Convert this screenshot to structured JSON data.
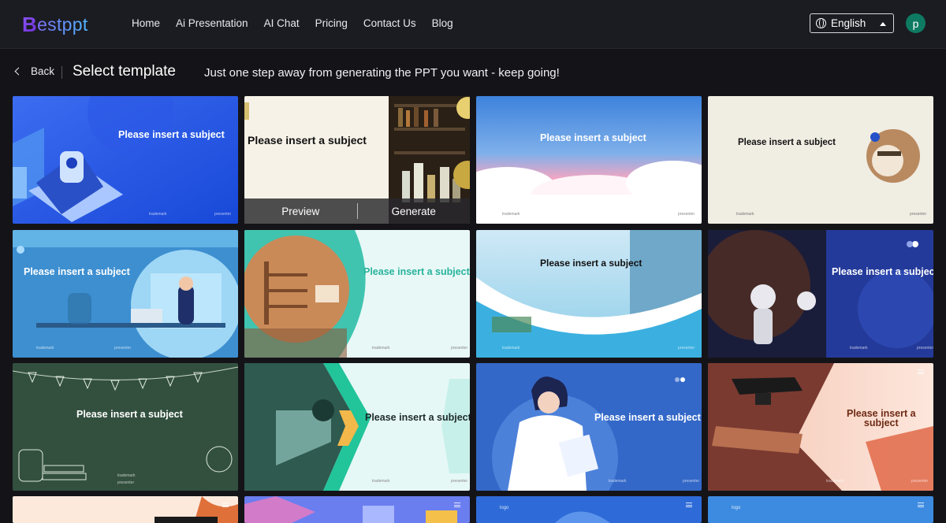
{
  "brand": {
    "b": "B",
    "rest": "estppt"
  },
  "nav": [
    "Home",
    "Ai Presentation",
    "AI Chat",
    "Pricing",
    "Contact Us",
    "Blog"
  ],
  "language": {
    "label": "English",
    "icon": "globe-icon"
  },
  "user": {
    "initial": "p",
    "color": "#0f7a62"
  },
  "header": {
    "back_label": "Back",
    "title": "Select template",
    "tagline": "Just one step away from generating the PPT you want - keep going!"
  },
  "hover_actions": {
    "preview": "Preview",
    "generate": "Generate"
  },
  "templates": [
    {
      "subject": "Please insert a subject",
      "theme": "blue-tech-laptop",
      "footer_left": "trademark",
      "footer_right": "presenter"
    },
    {
      "subject": "Please insert a subject",
      "theme": "cream-bottles"
    },
    {
      "subject": "Please insert a subject",
      "theme": "blue-sky-clouds",
      "footer_left": "trademark",
      "footer_right": "presenter"
    },
    {
      "subject": "Please insert a subject",
      "theme": "beige-photo-circle",
      "footer_left": "trademark",
      "footer_right": "presenter"
    },
    {
      "subject": "Please insert a subject",
      "theme": "blue-office-woman",
      "footer_left": "trademark",
      "footer_right": "presenter"
    },
    {
      "subject": "Please insert a subject",
      "theme": "teal-shelf",
      "footer_left": "trademark",
      "footer_right": "presenter"
    },
    {
      "subject": "Please insert a subject",
      "theme": "blue-glass-building",
      "footer_left": "trademark",
      "footer_right": "presenter"
    },
    {
      "subject": "Please insert a subject",
      "theme": "navy-robots",
      "footer_left": "trademark",
      "footer_right": "presenter"
    },
    {
      "subject": "Please insert a subject",
      "theme": "chalkboard",
      "footer_left": "trademark",
      "footer_right": "presenter"
    },
    {
      "subject": "Please insert a subject",
      "theme": "mint-classroom",
      "footer_left": "trademark",
      "footer_right": "presenter"
    },
    {
      "subject": "Please insert a subject",
      "theme": "blue-doctor",
      "footer_left": "trademark",
      "footer_right": "presenter"
    },
    {
      "subject": "Please insert a\nsubject",
      "theme": "peach-graduation",
      "footer_left": "trademark",
      "footer_right": "presenter"
    }
  ],
  "partial_row_tags": [
    "",
    "",
    "logo",
    "logo"
  ]
}
